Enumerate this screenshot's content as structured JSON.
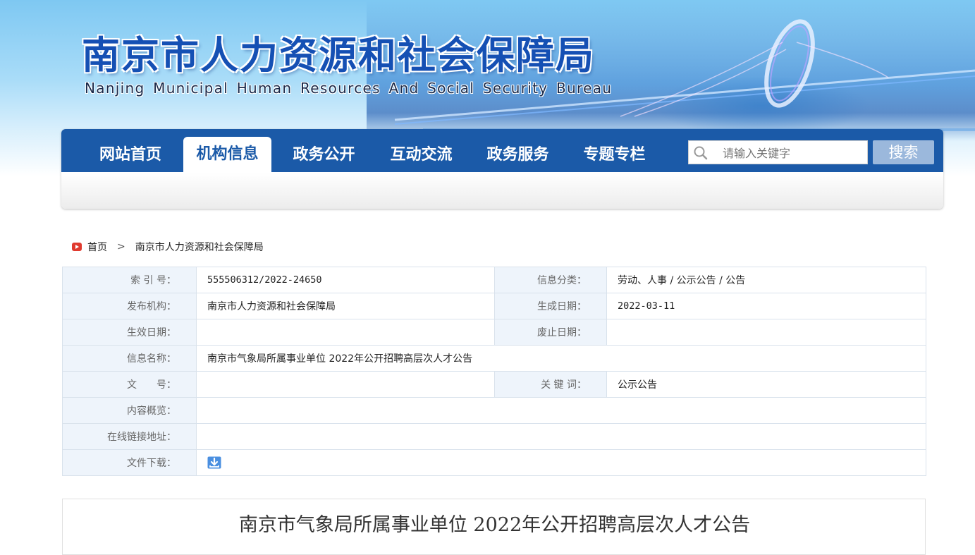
{
  "header": {
    "site_title": "南京市人力资源和社会保障局",
    "site_subtitle": "Nanjing Municipal Human Resources And Social Security Bureau"
  },
  "nav": {
    "items": [
      {
        "label": "网站首页",
        "active": false
      },
      {
        "label": "机构信息",
        "active": true
      },
      {
        "label": "政务公开",
        "active": false
      },
      {
        "label": "互动交流",
        "active": false
      },
      {
        "label": "政务服务",
        "active": false
      },
      {
        "label": "专题专栏",
        "active": false
      }
    ],
    "search": {
      "placeholder": "请输入关键字",
      "button_label": "搜索"
    }
  },
  "breadcrumb": {
    "home": "首页",
    "separator": ">",
    "current": "南京市人力资源和社会保障局"
  },
  "info": {
    "index_label": "索 引 号：",
    "index_value": "555506312/2022-24650",
    "category_label": "信息分类：",
    "category_value": "劳动、人事 / 公示公告 / 公告",
    "publisher_label": "发布机构：",
    "publisher_value": "南京市人力资源和社会保障局",
    "created_label": "生成日期：",
    "created_value": "2022-03-11",
    "effective_label": "生效日期：",
    "effective_value": "",
    "abolished_label": "废止日期：",
    "abolished_value": "",
    "name_label": "信息名称：",
    "name_value": "南京市气象局所属事业单位 2022年公开招聘高层次人才公告",
    "doc_no_label": "文　　号：",
    "doc_no_value": "",
    "keywords_label": "关 键 词：",
    "keywords_value": "公示公告",
    "summary_label": "内容概览：",
    "summary_value": "",
    "link_label": "在线链接地址：",
    "link_value": "",
    "download_label": "文件下载："
  },
  "article": {
    "title": "南京市气象局所属事业单位 2022年公开招聘高层次人才公告"
  },
  "colors": {
    "nav_blue": "#1b5aa8",
    "title_blue": "#1550b4",
    "label_bg": "#eef4fb"
  }
}
